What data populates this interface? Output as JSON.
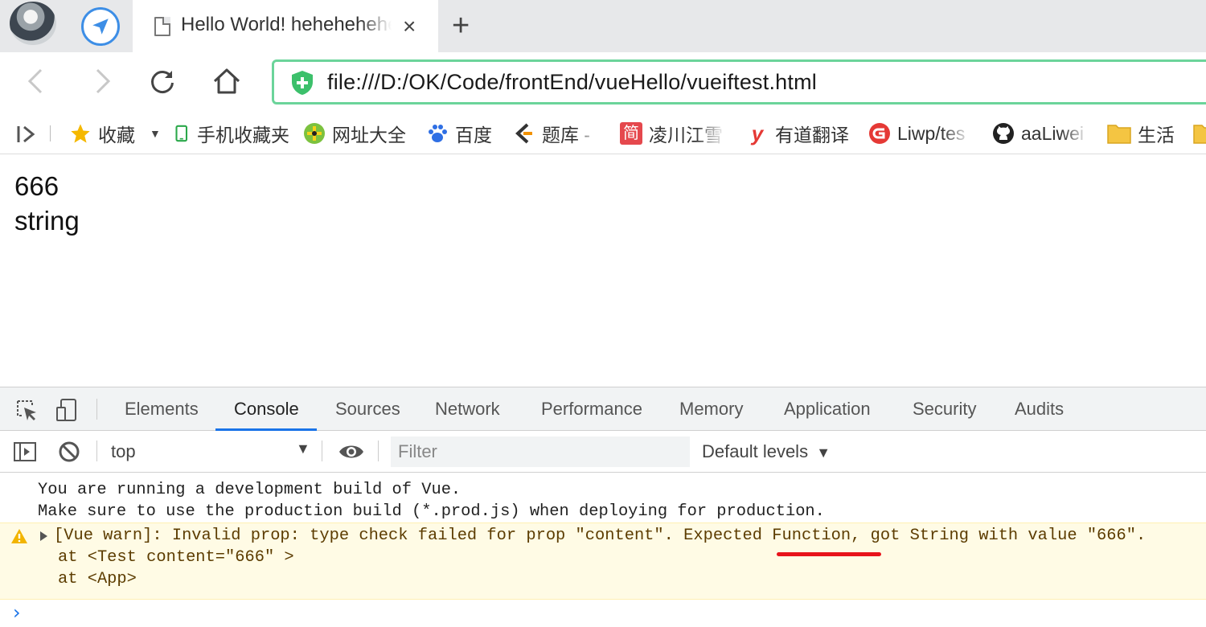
{
  "tab": {
    "title": "Hello World! hehehehehe",
    "close": "×",
    "new_tab": "+"
  },
  "omnibox": {
    "url": "file:///D:/OK/Code/frontEnd/vueHello/vueiftest.html"
  },
  "bookmarks": {
    "items": [
      {
        "label": "收藏",
        "icon": "star-icon"
      },
      {
        "label": "手机收藏夹",
        "icon": "phone-icon"
      },
      {
        "label": "网址大全",
        "icon": "compass-icon"
      },
      {
        "label": "百度",
        "icon": "paw-icon"
      },
      {
        "label": "题库 -",
        "icon": "chevron-logo-icon"
      },
      {
        "label": "凌川江雪",
        "icon": "jian-logo-icon"
      },
      {
        "label": "有道翻译",
        "icon": "youdao-icon"
      },
      {
        "label": "Liwp/tes",
        "icon": "gitee-icon"
      },
      {
        "label": "aaLiwei",
        "icon": "github-icon"
      },
      {
        "label": "生活",
        "icon": "folder-icon"
      }
    ],
    "colors": {
      "star": "#f5b800",
      "phone": "#2aa84a",
      "folder": "#f4c542",
      "red": "#e53935",
      "baidu": "#2f6fe4"
    }
  },
  "page": {
    "line1": "666",
    "line2": "string"
  },
  "devtools": {
    "tabs": [
      "Elements",
      "Console",
      "Sources",
      "Network",
      "Performance",
      "Memory",
      "Application",
      "Security",
      "Audits"
    ],
    "active_tab": "Console",
    "context": "top",
    "filter_placeholder": "Filter",
    "levels": "Default levels",
    "levels_arrow": "▼",
    "accent": "#1a73e8"
  },
  "console": {
    "info_line1": "You are running a development build of Vue.",
    "info_line2": "Make sure to use the production build (*.prod.js) when deploying for production.",
    "warn_line1": "[Vue warn]: Invalid prop: type check failed for prop \"content\". Expected Function, got String with value \"666\".",
    "warn_line2": "at <Test content=\"666\" >",
    "warn_line3": "at <App>",
    "prompt": "›",
    "warn_bg": "#fffbe5",
    "highlight_color": "#e8131b"
  }
}
